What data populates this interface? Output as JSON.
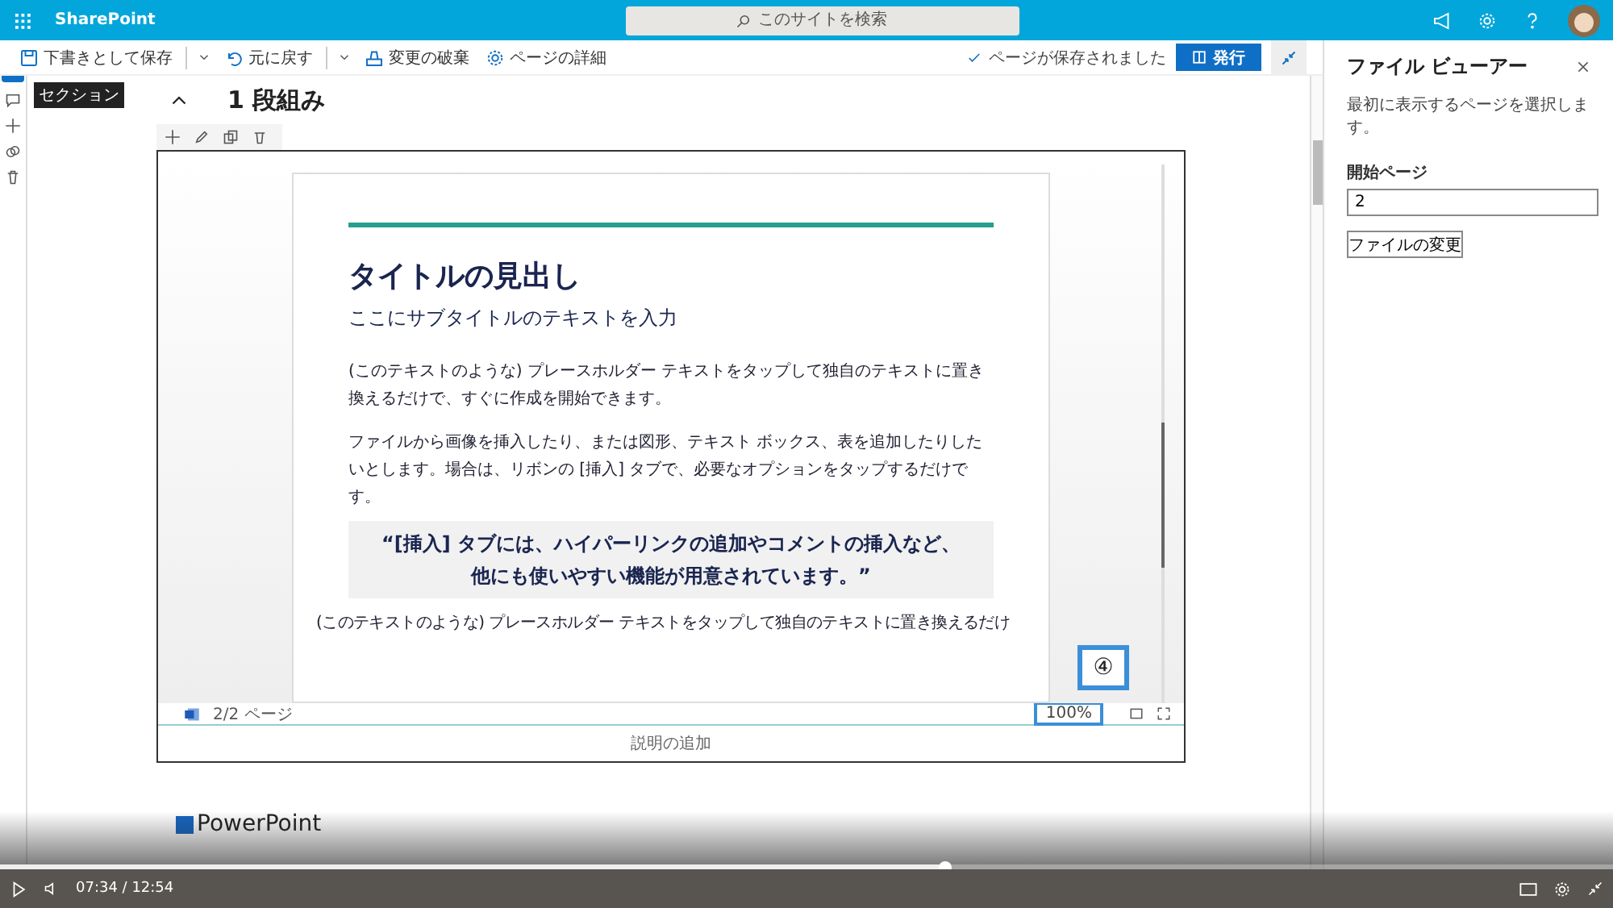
{
  "top_bar": {
    "app_name": "SharePoint",
    "search": {
      "placeholder": "このサイトを検索"
    }
  },
  "command_bar": {
    "items": [
      {
        "label": "下書きとして保存",
        "kind": "save",
        "has_menu": true
      },
      {
        "label": "元に戻す",
        "kind": "undo",
        "has_menu": true
      },
      {
        "label": "変更の破棄",
        "kind": "discard",
        "has_menu": false
      },
      {
        "label": "ページの詳細",
        "kind": "gear",
        "has_menu": false
      }
    ],
    "status": "ページが保存されました",
    "publish": "発行"
  },
  "rail": {
    "tooltip": "セクション"
  },
  "section": {
    "title": "1 段組み",
    "expanded": true
  },
  "viewer": {
    "document": {
      "title": "タイトルの見出し",
      "subtitle": "ここにサブタイトルのテキストを入力",
      "paragraphs": [
        "(このテキストのような) プレースホルダー テキストをタップして独自のテキストに置き換えるだけで、すぐに作成を開始できます。",
        "ファイルから画像を挿入したり、または図形、テキスト ボックス、表を追加したりしたいとします。場合は、リボンの [挿入] タブで、必要なオプションをタップするだけです。"
      ],
      "quote": "“[挿入] タブには、ハイパーリンクの追加やコメントの挿入など、他にも使いやすい機能が用意されています。”",
      "trailing": "(このテキストのような) プレースホルダー テキストをタップして独自のテキストに置き換えるだけ"
    },
    "page_indicator": "2/2 ページ",
    "zoom": "100%",
    "caption_placeholder": "説明の追加",
    "callout": "④"
  },
  "next_heading": "PowerPoint",
  "panel": {
    "title": "ファイル ビューアー",
    "description": "最初に表示するページを選択します。",
    "field_label": "開始ページ",
    "field_value": "2",
    "button": "ファイルの変更"
  },
  "video": {
    "time": "07:34 / 12:54",
    "progress": {
      "level": 0.586
    }
  }
}
